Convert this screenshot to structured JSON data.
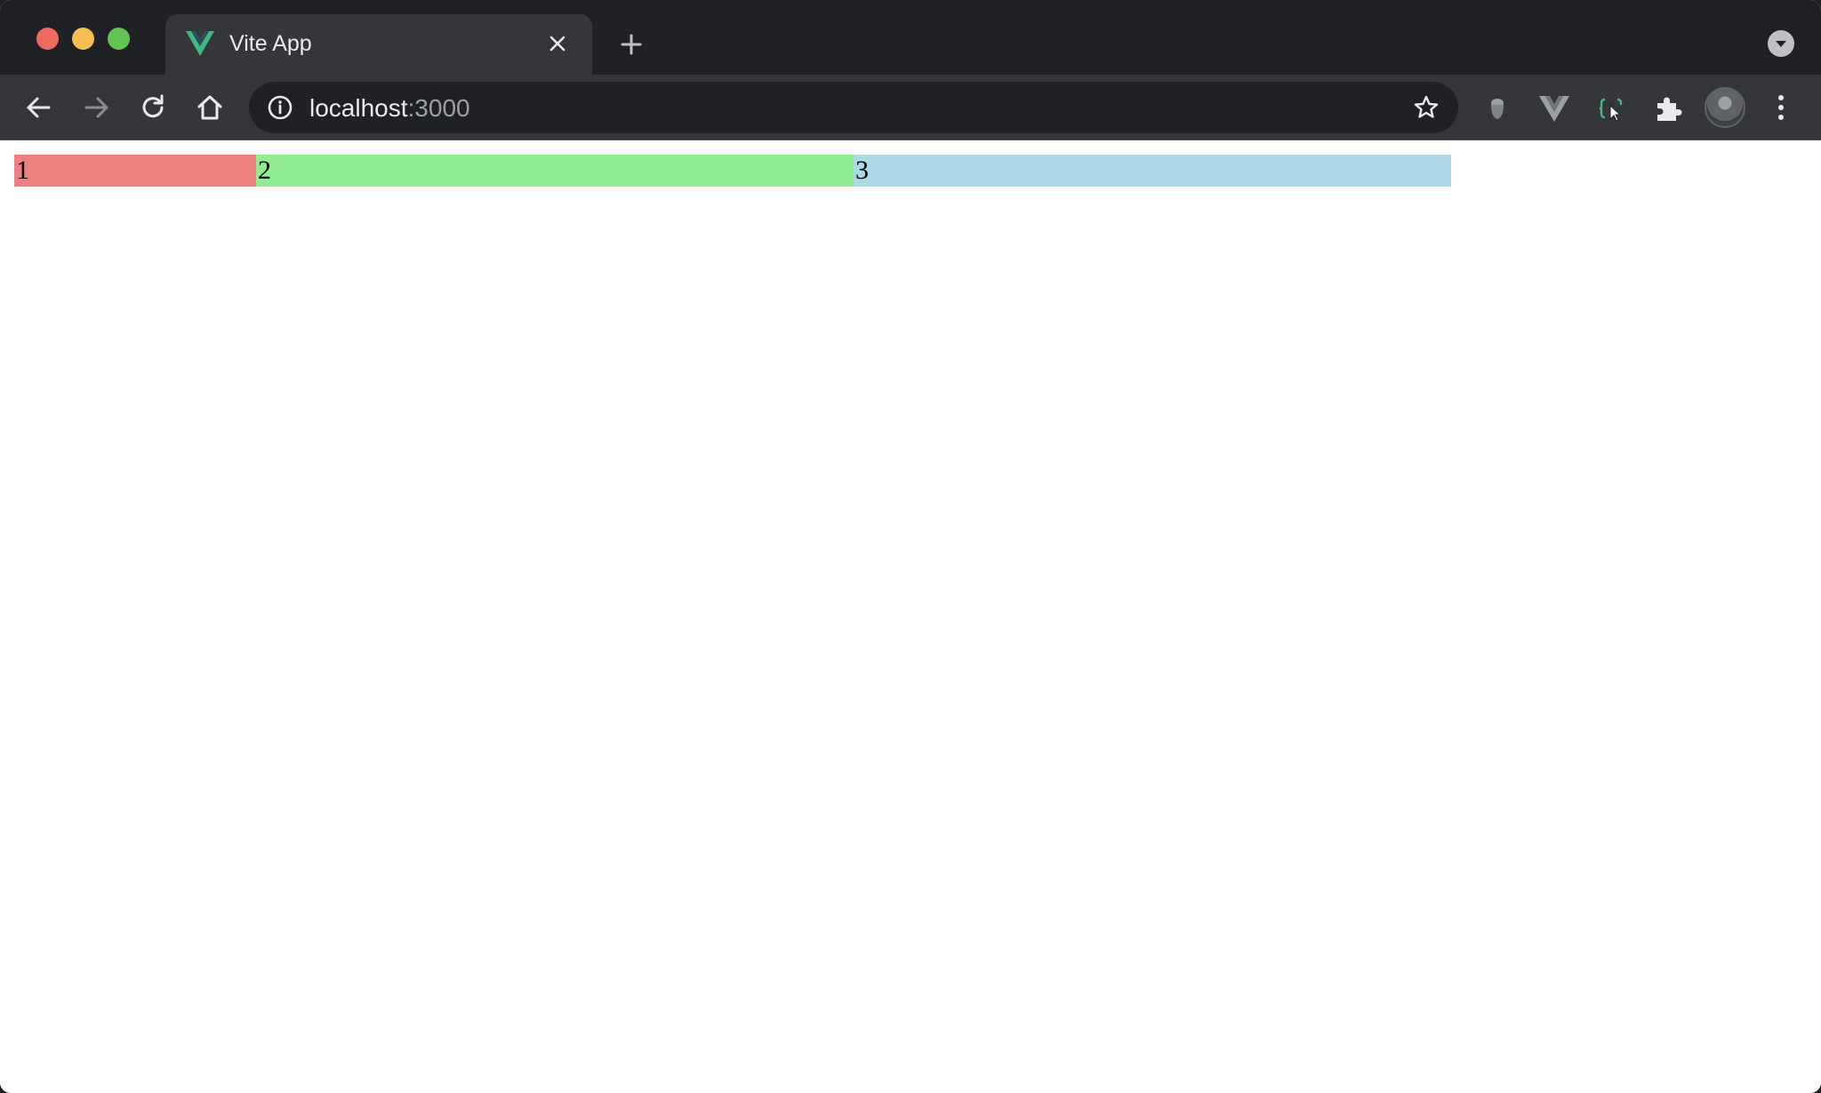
{
  "browser": {
    "tab": {
      "title": "Vite App"
    },
    "address": {
      "host": "localhost",
      "port": ":3000"
    }
  },
  "page": {
    "boxes": [
      {
        "label": "1",
        "color": "#f08080"
      },
      {
        "label": "2",
        "color": "#90ee90"
      },
      {
        "label": "3",
        "color": "#add8e6"
      }
    ]
  },
  "colors": {
    "titlebar": "#202124",
    "toolbar": "#35363a",
    "vue_green": "#42b883",
    "vue_dark": "#35495e"
  },
  "icons": [
    "close-icon",
    "plus-icon",
    "back-arrow-icon",
    "forward-arrow-icon",
    "reload-icon",
    "home-icon",
    "info-icon",
    "star-icon",
    "extension-puzzle-icon",
    "kebab-menu-icon"
  ]
}
